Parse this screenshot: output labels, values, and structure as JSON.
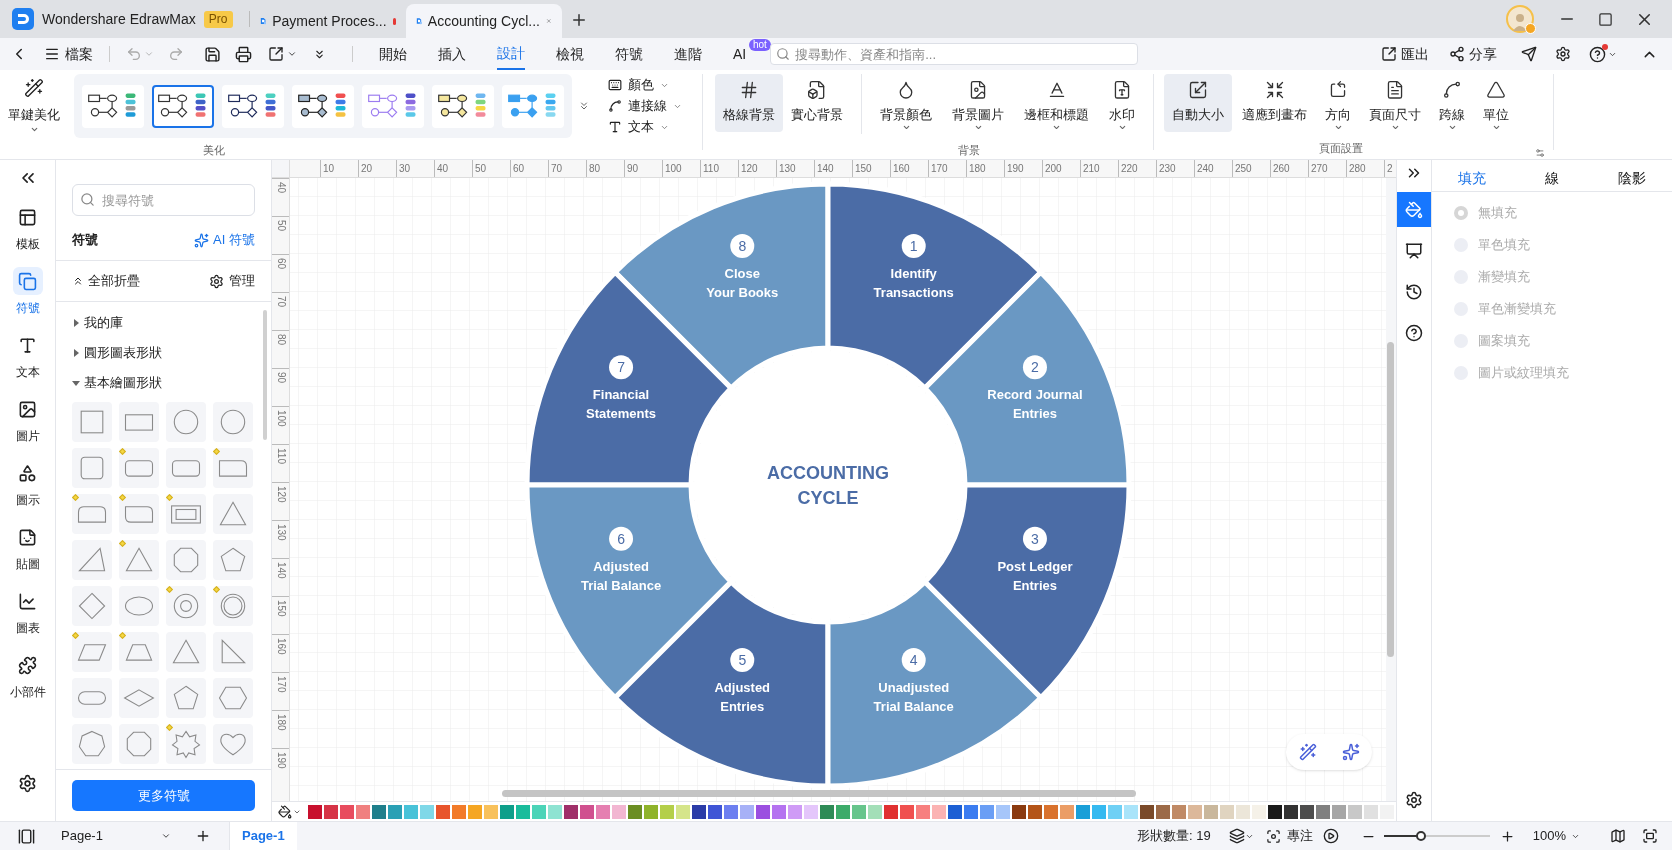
{
  "title_bar": {
    "app_tab": {
      "name": "Wondershare EdrawMax",
      "badge": "Pro"
    },
    "doc_tabs": [
      {
        "title": "Payment Proces...",
        "selected": false,
        "modified": true
      },
      {
        "title": "Accounting Cycl...",
        "selected": true,
        "modified": false
      }
    ]
  },
  "menu_bar": {
    "file": "檔案",
    "undo": {
      "disabled": true
    },
    "redo": {
      "disabled": true
    },
    "tabs": [
      {
        "label": "開始",
        "selected": false
      },
      {
        "label": "插入",
        "selected": false
      },
      {
        "label": "設計",
        "selected": true
      },
      {
        "label": "檢視",
        "selected": false
      },
      {
        "label": "符號",
        "selected": false
      },
      {
        "label": "進階",
        "selected": false
      },
      {
        "label": "AI",
        "selected": false,
        "badge": "hot"
      }
    ],
    "search": {
      "placeholder": "搜尋動作、資產和指南..."
    },
    "export": "匯出",
    "share": "分享",
    "help_notification": true
  },
  "ribbon": {
    "beautify_group": {
      "label": "美化",
      "button": "單鍵美化",
      "themes": [
        {
          "selected": false
        },
        {
          "selected": true
        },
        {
          "selected": false
        },
        {
          "selected": false
        },
        {
          "selected": false
        },
        {
          "selected": false
        },
        {
          "selected": false
        }
      ],
      "menus": [
        {
          "label": "顏色"
        },
        {
          "label": "連接線"
        },
        {
          "label": "文本"
        }
      ]
    },
    "background_group": {
      "label": "背景",
      "toggles": [
        {
          "label": "格線背景",
          "selected": true,
          "has_menu": false
        },
        {
          "label": "實心背景",
          "selected": false,
          "has_menu": false
        }
      ],
      "buttons": [
        {
          "label": "背景顏色",
          "selected": false,
          "has_menu": true
        },
        {
          "label": "背景圖片",
          "selected": false,
          "has_menu": true
        },
        {
          "label": "邊框和標題",
          "selected": false,
          "has_menu": true
        },
        {
          "label": "水印",
          "selected": false,
          "has_menu": true
        }
      ]
    },
    "page_group": {
      "label": "頁面設置",
      "buttons": [
        {
          "label": "自動大小",
          "selected": true,
          "has_menu": false
        },
        {
          "label": "適應到畫布",
          "selected": false,
          "has_menu": false
        },
        {
          "label": "方向",
          "selected": false,
          "has_menu": true
        },
        {
          "label": "頁面尺寸",
          "selected": false,
          "has_menu": true
        },
        {
          "label": "跨線",
          "selected": false,
          "has_menu": true
        },
        {
          "label": "單位",
          "selected": false,
          "has_menu": true
        }
      ]
    }
  },
  "left_rail": [
    {
      "label": "模板",
      "selected": false
    },
    {
      "label": "符號",
      "selected": true
    },
    {
      "label": "文本",
      "selected": false
    },
    {
      "label": "圖片",
      "selected": false
    },
    {
      "label": "圖示",
      "selected": false
    },
    {
      "label": "貼圖",
      "selected": false
    },
    {
      "label": "圖表",
      "selected": false
    },
    {
      "label": "小部件",
      "selected": false
    }
  ],
  "symbols_panel": {
    "search": {
      "placeholder": "搜尋符號"
    },
    "title": "符號",
    "ai_button": "AI 符號",
    "collapse_all": "全部折疊",
    "manage": "管理",
    "categories": [
      {
        "label": "我的庫",
        "expanded": false
      },
      {
        "label": "圓形圖表形狀",
        "expanded": false
      },
      {
        "label": "基本繪圖形狀",
        "expanded": true
      }
    ],
    "shapes": [
      {
        "kind": "square",
        "marked": false
      },
      {
        "kind": "rectangle",
        "marked": false
      },
      {
        "kind": "circle",
        "marked": false
      },
      {
        "kind": "circle",
        "marked": false
      },
      {
        "kind": "rounded-square",
        "marked": false
      },
      {
        "kind": "rounded-rectangle",
        "marked": true
      },
      {
        "kind": "rounded-rectangle",
        "marked": false
      },
      {
        "kind": "snip-rectangle",
        "marked": true
      },
      {
        "kind": "top-rounded",
        "marked": true
      },
      {
        "kind": "corner-rounded",
        "marked": true
      },
      {
        "kind": "frame",
        "marked": true
      },
      {
        "kind": "triangle",
        "marked": false
      },
      {
        "kind": "scalene",
        "marked": false
      },
      {
        "kind": "triangle",
        "marked": true
      },
      {
        "kind": "octagon",
        "marked": false
      },
      {
        "kind": "pentagon",
        "marked": false
      },
      {
        "kind": "diamond",
        "marked": false
      },
      {
        "kind": "ellipse",
        "marked": false
      },
      {
        "kind": "ring",
        "marked": true
      },
      {
        "kind": "double-circle",
        "marked": true
      },
      {
        "kind": "parallelogram",
        "marked": true
      },
      {
        "kind": "trapezoid",
        "marked": true
      },
      {
        "kind": "triangle",
        "marked": false
      },
      {
        "kind": "right-triangle",
        "marked": false
      },
      {
        "kind": "stadium",
        "marked": false
      },
      {
        "kind": "rhombus",
        "marked": false
      },
      {
        "kind": "pentagon",
        "marked": false
      },
      {
        "kind": "hexagon",
        "marked": false
      },
      {
        "kind": "heptagon",
        "marked": false
      },
      {
        "kind": "octagon",
        "marked": false
      },
      {
        "kind": "starburst",
        "marked": true
      },
      {
        "kind": "heart",
        "marked": false
      }
    ],
    "more_button": "更多符號"
  },
  "canvas": {
    "h_ruler": [
      "10",
      "20",
      "30",
      "40",
      "50",
      "60",
      "70",
      "80",
      "90",
      "100",
      "110",
      "120",
      "130",
      "140",
      "150",
      "160",
      "170",
      "180",
      "190",
      "200",
      "210",
      "220",
      "230",
      "240",
      "250",
      "260",
      "270",
      "280",
      "2"
    ],
    "v_ruler": [
      "40",
      "50",
      "60",
      "70",
      "80",
      "90",
      "100",
      "110",
      "120",
      "130",
      "140",
      "150",
      "160",
      "170",
      "180",
      "190"
    ],
    "diagram": {
      "title_lines": [
        "ACCOUNTING",
        "CYCLE"
      ],
      "segments": [
        {
          "number": "8",
          "lines": [
            "Close",
            "Your Books"
          ],
          "color": "#6a98c3"
        },
        {
          "number": "1",
          "lines": [
            "Identify",
            "Transactions"
          ],
          "color": "#4b6ca6"
        },
        {
          "number": "7",
          "lines": [
            "Financial",
            "Statements"
          ],
          "color": "#4b6ca6"
        },
        {
          "number": "2",
          "lines": [
            "Record Journal",
            "Entries"
          ],
          "color": "#6a98c3"
        },
        {
          "number": "6",
          "lines": [
            "Adjusted",
            "Trial Balance"
          ],
          "color": "#6a98c3"
        },
        {
          "number": "3",
          "lines": [
            "Post Ledger",
            "Entries"
          ],
          "color": "#4b6ca6"
        },
        {
          "number": "5",
          "lines": [
            "Adjusted",
            "Entries"
          ],
          "color": "#4b6ca6"
        },
        {
          "number": "4",
          "lines": [
            "Unadjusted",
            "Trial Balance"
          ],
          "color": "#6a98c3"
        }
      ]
    }
  },
  "palette": [
    {
      "color": "#c8102e"
    },
    {
      "color": "#d63447"
    },
    {
      "color": "#e84c5e"
    },
    {
      "color": "#f08080"
    },
    {
      "color": "#1f7f8c"
    },
    {
      "color": "#2aa0b5"
    },
    {
      "color": "#48c2d8"
    },
    {
      "color": "#7fd8e8"
    },
    {
      "color": "#e8542c"
    },
    {
      "color": "#f27b2a"
    },
    {
      "color": "#f5a623"
    },
    {
      "color": "#f8c15c"
    },
    {
      "color": "#0e9f8a"
    },
    {
      "color": "#1abc9c"
    },
    {
      "color": "#4cd4b8"
    },
    {
      "color": "#8ee3d2"
    },
    {
      "color": "#a0306a"
    },
    {
      "color": "#d0508f"
    },
    {
      "color": "#e57fb1"
    },
    {
      "color": "#f2b6d2"
    },
    {
      "color": "#6b8e23"
    },
    {
      "color": "#8fb32b"
    },
    {
      "color": "#b4cf4a"
    },
    {
      "color": "#d5e58a"
    },
    {
      "color": "#2b3ca8"
    },
    {
      "color": "#3f55d6"
    },
    {
      "color": "#6d7ff0"
    },
    {
      "color": "#a7b1f7"
    },
    {
      "color": "#9b4fe0"
    },
    {
      "color": "#b573f0"
    },
    {
      "color": "#cf9bf6"
    },
    {
      "color": "#e4c6fb"
    },
    {
      "color": "#2e8b57"
    },
    {
      "color": "#3cab6a"
    },
    {
      "color": "#67c58c"
    },
    {
      "color": "#a3dfb8"
    },
    {
      "color": "#e03131"
    },
    {
      "color": "#f0504f"
    },
    {
      "color": "#f77f7f"
    },
    {
      "color": "#fbb3b3"
    },
    {
      "color": "#1c5fd4"
    },
    {
      "color": "#3b7cf0"
    },
    {
      "color": "#6a9ef5"
    },
    {
      "color": "#a6c6fa"
    },
    {
      "color": "#8b3a0f"
    },
    {
      "color": "#b45418"
    },
    {
      "color": "#d9722e"
    },
    {
      "color": "#eb9d66"
    },
    {
      "color": "#1a9fd8"
    },
    {
      "color": "#35b9f0"
    },
    {
      "color": "#6fd0f5"
    },
    {
      "color": "#a9e4fa"
    },
    {
      "color": "#7a4a2a"
    },
    {
      "color": "#9c6a48"
    },
    {
      "color": "#c08a66"
    },
    {
      "color": "#dcb89a"
    },
    {
      "color": "#c9b79c"
    },
    {
      "color": "#e0d4c0"
    },
    {
      "color": "#ece6d9"
    },
    {
      "color": "#f5f1e8"
    },
    {
      "color": "#1a1a1a"
    },
    {
      "color": "#333333"
    },
    {
      "color": "#4d4d4d"
    },
    {
      "color": "#808080"
    },
    {
      "color": "#a6a6a6"
    },
    {
      "color": "#c8c8c8"
    },
    {
      "color": "#e0e0e0"
    },
    {
      "color": "#f2f2f2"
    }
  ],
  "right_rail": [
    {
      "selected": true
    },
    {
      "selected": false
    },
    {
      "selected": false
    },
    {
      "selected": false
    }
  ],
  "right_panel": {
    "tabs": [
      {
        "label": "填充",
        "selected": true
      },
      {
        "label": "線",
        "selected": false
      },
      {
        "label": "陰影",
        "selected": false
      }
    ],
    "options": [
      {
        "label": "無填充",
        "selected": true,
        "disabled": true
      },
      {
        "label": "單色填充",
        "selected": false,
        "disabled": true
      },
      {
        "label": "漸變填充",
        "selected": false,
        "disabled": true
      },
      {
        "label": "單色漸變填充",
        "selected": false,
        "disabled": true
      },
      {
        "label": "圖案填充",
        "selected": false,
        "disabled": true
      },
      {
        "label": "圖片或紋理填充",
        "selected": false,
        "disabled": true
      }
    ]
  },
  "status_bar": {
    "page_selector": "Page-1",
    "page_tabs": [
      {
        "label": "Page-1",
        "selected": true
      }
    ],
    "shape_count": "形狀數量: 19",
    "focus": "專注",
    "zoom": {
      "level": 0.35,
      "reading": "100%"
    }
  }
}
